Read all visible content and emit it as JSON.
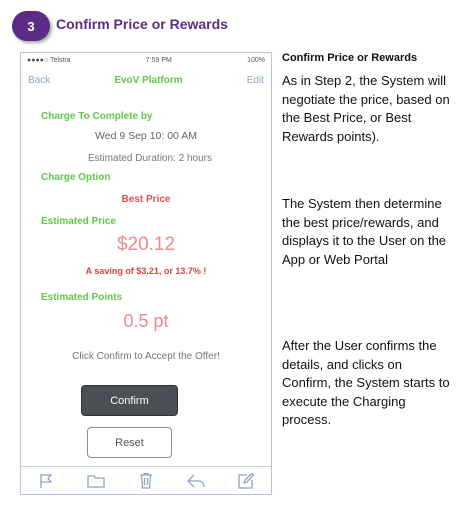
{
  "step": {
    "number": "3",
    "title": "Confirm Price or Rewards"
  },
  "phone": {
    "status": {
      "carrier": "●●●●○ Telstra",
      "time": "7:59 PM",
      "battery": "100%"
    },
    "nav": {
      "back": "Back",
      "title": "EvoV Platform",
      "edit": "Edit"
    },
    "charge_to_complete": {
      "label": "Charge To Complete by",
      "datetime": "Wed 9 Sep 10: 00 AM",
      "duration": "Estimated Duration: 2 hours"
    },
    "charge_option": {
      "label": "Charge Option",
      "value": "Best Price"
    },
    "estimated_price": {
      "label": "Estimated Price",
      "value": "$20.12",
      "saving": "A saving of $3.21, or 13.7% !"
    },
    "estimated_points": {
      "label": "Estimated Points",
      "value": "0.5 pt"
    },
    "instruction": "Click Confirm to Accept the Offer!",
    "buttons": {
      "confirm": "Confirm",
      "reset": "Reset"
    },
    "toolbar_icons": [
      "flag-icon",
      "folder-icon",
      "trash-icon",
      "reply-icon",
      "compose-icon"
    ],
    "colors": {
      "green": "#62c84a",
      "red": "#f08a8a",
      "dark_red": "#e04040",
      "purple": "#5b2c83"
    }
  },
  "side": {
    "heading": "Confirm Price or Rewards",
    "para1": "As in Step 2, the System will negotiate the price, based on the Best Price, or Best Rewards points).",
    "para2": "The System then determine the best price/rewards, and displays it to the User on the App or Web Portal",
    "para3": "After the User confirms the details, and clicks on Confirm, the System starts to execute the Charging process."
  }
}
